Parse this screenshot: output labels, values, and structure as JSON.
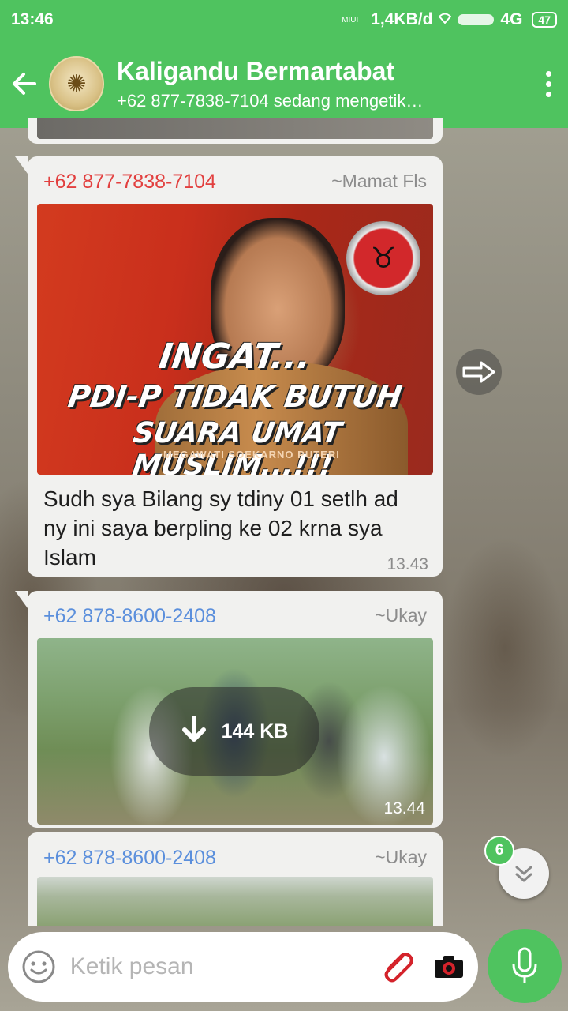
{
  "status_bar": {
    "time": "13:46",
    "carrier_label": "MIUI",
    "network_speed": "1,4KB/d",
    "network_type": "4G",
    "battery": "47"
  },
  "header": {
    "title": "Kaligandu Bermartabat",
    "subtitle": "+62 877-7838-7104 sedang mengetik…",
    "avatar_icon": "calligraphy-avatar",
    "accent_color": "#4fc35f"
  },
  "messages": [
    {
      "sender": "+62 877-7838-7104",
      "sender_color": "#e2403f",
      "alias": "~Mamat Fls",
      "image": {
        "lines": [
          "INGAT...",
          "PDI-P TIDAK BUTUH",
          "SUARA UMAT MUSLIM...!!!"
        ],
        "credit": "MEGAWATI SOEKARNO PUTERI"
      },
      "caption": "Sudh sya Bilang sy tdiny 01 setlh ad ny ini saya berpling ke 02 krna sya Islam",
      "time": "13.43"
    },
    {
      "sender": "+62 878-8600-2408",
      "sender_color": "#5b8fdc",
      "alias": "~Ukay",
      "download_size": "144 KB",
      "time": "13.44"
    },
    {
      "sender": "+62 878-8600-2408",
      "sender_color": "#5b8fdc",
      "alias": "~Ukay"
    }
  ],
  "unread_count": "6",
  "composer": {
    "placeholder": "Ketik pesan"
  }
}
